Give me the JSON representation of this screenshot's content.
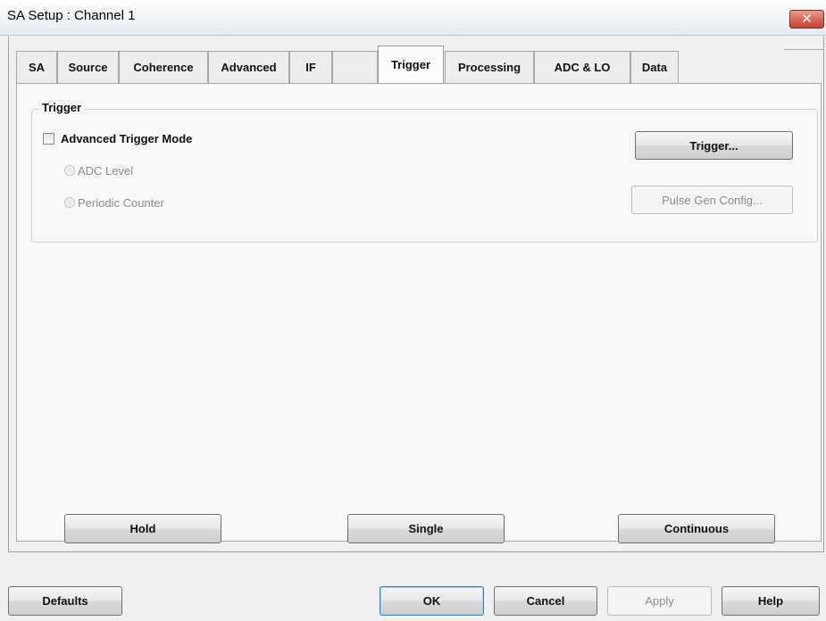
{
  "window": {
    "title": "SA Setup : Channel 1",
    "close_glyph": "✕",
    "close_icon": "close-icon"
  },
  "tabs": [
    {
      "label": "SA"
    },
    {
      "label": "Source"
    },
    {
      "label": "Coherence"
    },
    {
      "label": "Advanced"
    },
    {
      "label": "IF"
    },
    {
      "label": "Trigger",
      "active": true
    },
    {
      "label": "Processing"
    },
    {
      "label": "ADC & LO"
    },
    {
      "label": "Data"
    }
  ],
  "trigger_group": {
    "label": "Trigger",
    "advanced_mode_label": "Advanced Trigger Mode",
    "advanced_mode_checked": false,
    "radio_adc_level": "ADC Level",
    "radio_periodic_counter": "Periodic Counter",
    "trigger_button": "Trigger...",
    "pulse_gen_button": "Pulse Gen Config..."
  },
  "sweep_controls": {
    "hold": "Hold",
    "single": "Single",
    "continuous": "Continuous"
  },
  "footer": {
    "defaults": "Defaults",
    "ok": "OK",
    "cancel": "Cancel",
    "apply": "Apply",
    "help": "Help"
  },
  "colors": {
    "close_button": "#c6402b",
    "default_button_border": "#3c7fb1",
    "disabled_text": "#8c8c8c"
  }
}
